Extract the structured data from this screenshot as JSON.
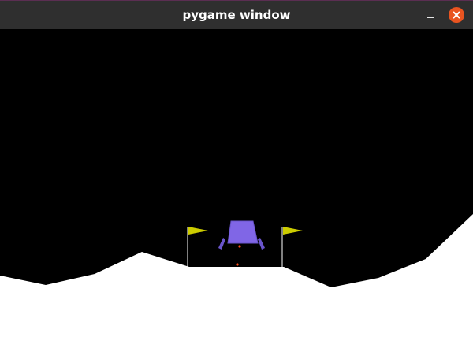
{
  "window": {
    "title": "pygame window"
  },
  "colors": {
    "titlebar": "#2f2f2f",
    "title_text": "#ffffff",
    "close_button": "#e95420",
    "sky": "#000000",
    "terrain": "#ffffff",
    "lander_body": "#8066e6",
    "lander_legs": "#6a55cc",
    "flags": "#cccc00",
    "particles": "#ff4d1a"
  },
  "icons": {
    "minimize": "minimize-icon",
    "close": "close-icon"
  }
}
